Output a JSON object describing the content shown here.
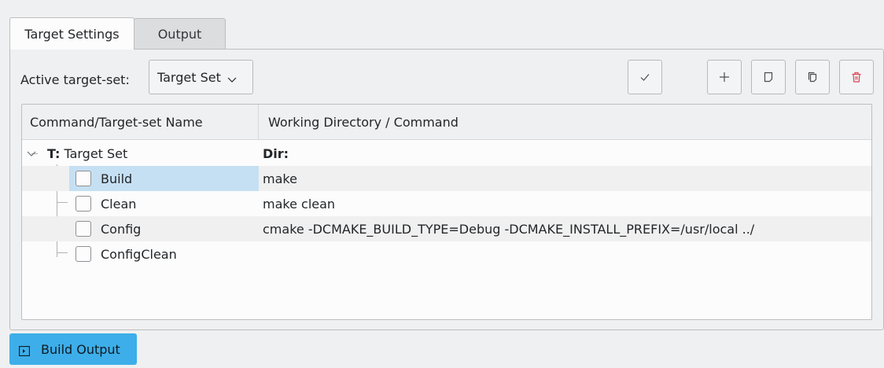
{
  "tabs": {
    "target_settings": "Target Settings",
    "output": "Output"
  },
  "toolbar": {
    "active_label": "Active target-set:",
    "combo_value": "Target Set"
  },
  "table": {
    "headers": [
      "Command/Target-set Name",
      "Working Directory / Command"
    ],
    "target_set": {
      "prefix": "T:",
      "name": "Target Set",
      "dir_label": "Dir:"
    },
    "rows": [
      {
        "name": "Build",
        "command": "make"
      },
      {
        "name": "Clean",
        "command": "make clean"
      },
      {
        "name": "Config",
        "command": "cmake -DCMAKE_BUILD_TYPE=Debug -DCMAKE_INSTALL_PREFIX=/usr/local ../"
      },
      {
        "name": "ConfigClean",
        "command": ""
      }
    ]
  },
  "bottom": {
    "build_output": "Build Output"
  },
  "colors": {
    "accent": "#3daee9",
    "selection": "#c6e0f3",
    "delete": "#da4453"
  },
  "icons": [
    "checkmark-icon",
    "plus-icon",
    "new-document-icon",
    "copy-icon",
    "trash-icon",
    "chevron-down-icon",
    "terminal-icon"
  ]
}
